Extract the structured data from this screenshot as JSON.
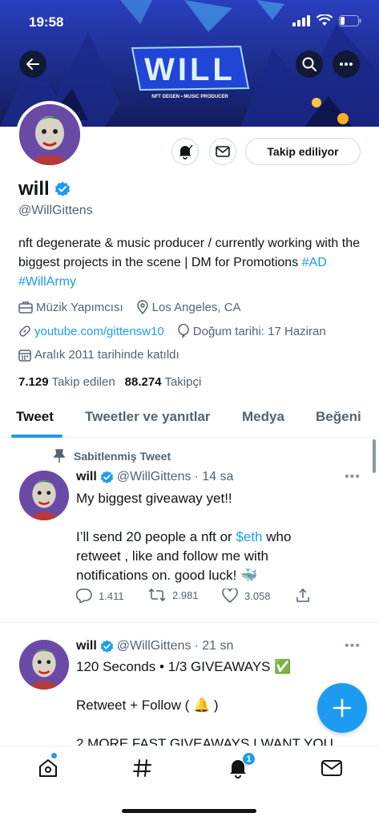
{
  "status_bar": {
    "time": "19:58"
  },
  "banner": {
    "logo_text": "WILL",
    "tagline": "NFT DEGEN • MUSIC PRODUCER"
  },
  "profile": {
    "name": "will",
    "handle": "@WillGittens",
    "follow_label": "Takip ediliyor",
    "bio_text": "nft degenerate & music producer / currently working with the biggest projects in the scene | DM for Promotions ",
    "bio_hashtags": [
      "#AD",
      "#WillArmy"
    ],
    "category": "Müzik Yapımcısı",
    "location": "Los Angeles, CA",
    "website": "youtube.com/gittensw10",
    "birthday": "Doğum tarihi: 17 Haziran",
    "joined": "Aralık 2011 tarihinde katıldı",
    "following_count": "7.129",
    "following_label": "Takip edilen",
    "followers_count": "88.274",
    "followers_label": "Takipçi"
  },
  "tabs": [
    "Tweet",
    "Tweetler ve yanıtlar",
    "Medya",
    "Beğeni"
  ],
  "tweets": [
    {
      "pinned_label": "Sabitlenmiş Tweet",
      "name": "will",
      "handle": "@WillGittens",
      "time": "· 14 sa",
      "line1": "My biggest giveaway yet!!",
      "line2_pre": "I’ll send 20 people a nft or ",
      "line2_tag": "$eth",
      "line2_post": " who",
      "line3": "retweet , like and follow me with",
      "line4": "notifications on. good luck! 🐳",
      "replies": "1.411",
      "retweets": "2.981",
      "likes": "3.058"
    },
    {
      "name": "will",
      "handle": "@WillGittens",
      "time": "· 21 sn",
      "line1": "120 Seconds • 1/3 GIVEAWAYS ✅",
      "line2": "Retweet + Follow ( 🔔 )",
      "line3": "2 MORE FAST GIVEAWAYS I WANT YOU"
    }
  ],
  "bottom_nav": {
    "notification_badge": "1"
  },
  "colors": {
    "accent": "#1d9bf0",
    "text": "#0f1419",
    "secondary": "#536471"
  }
}
